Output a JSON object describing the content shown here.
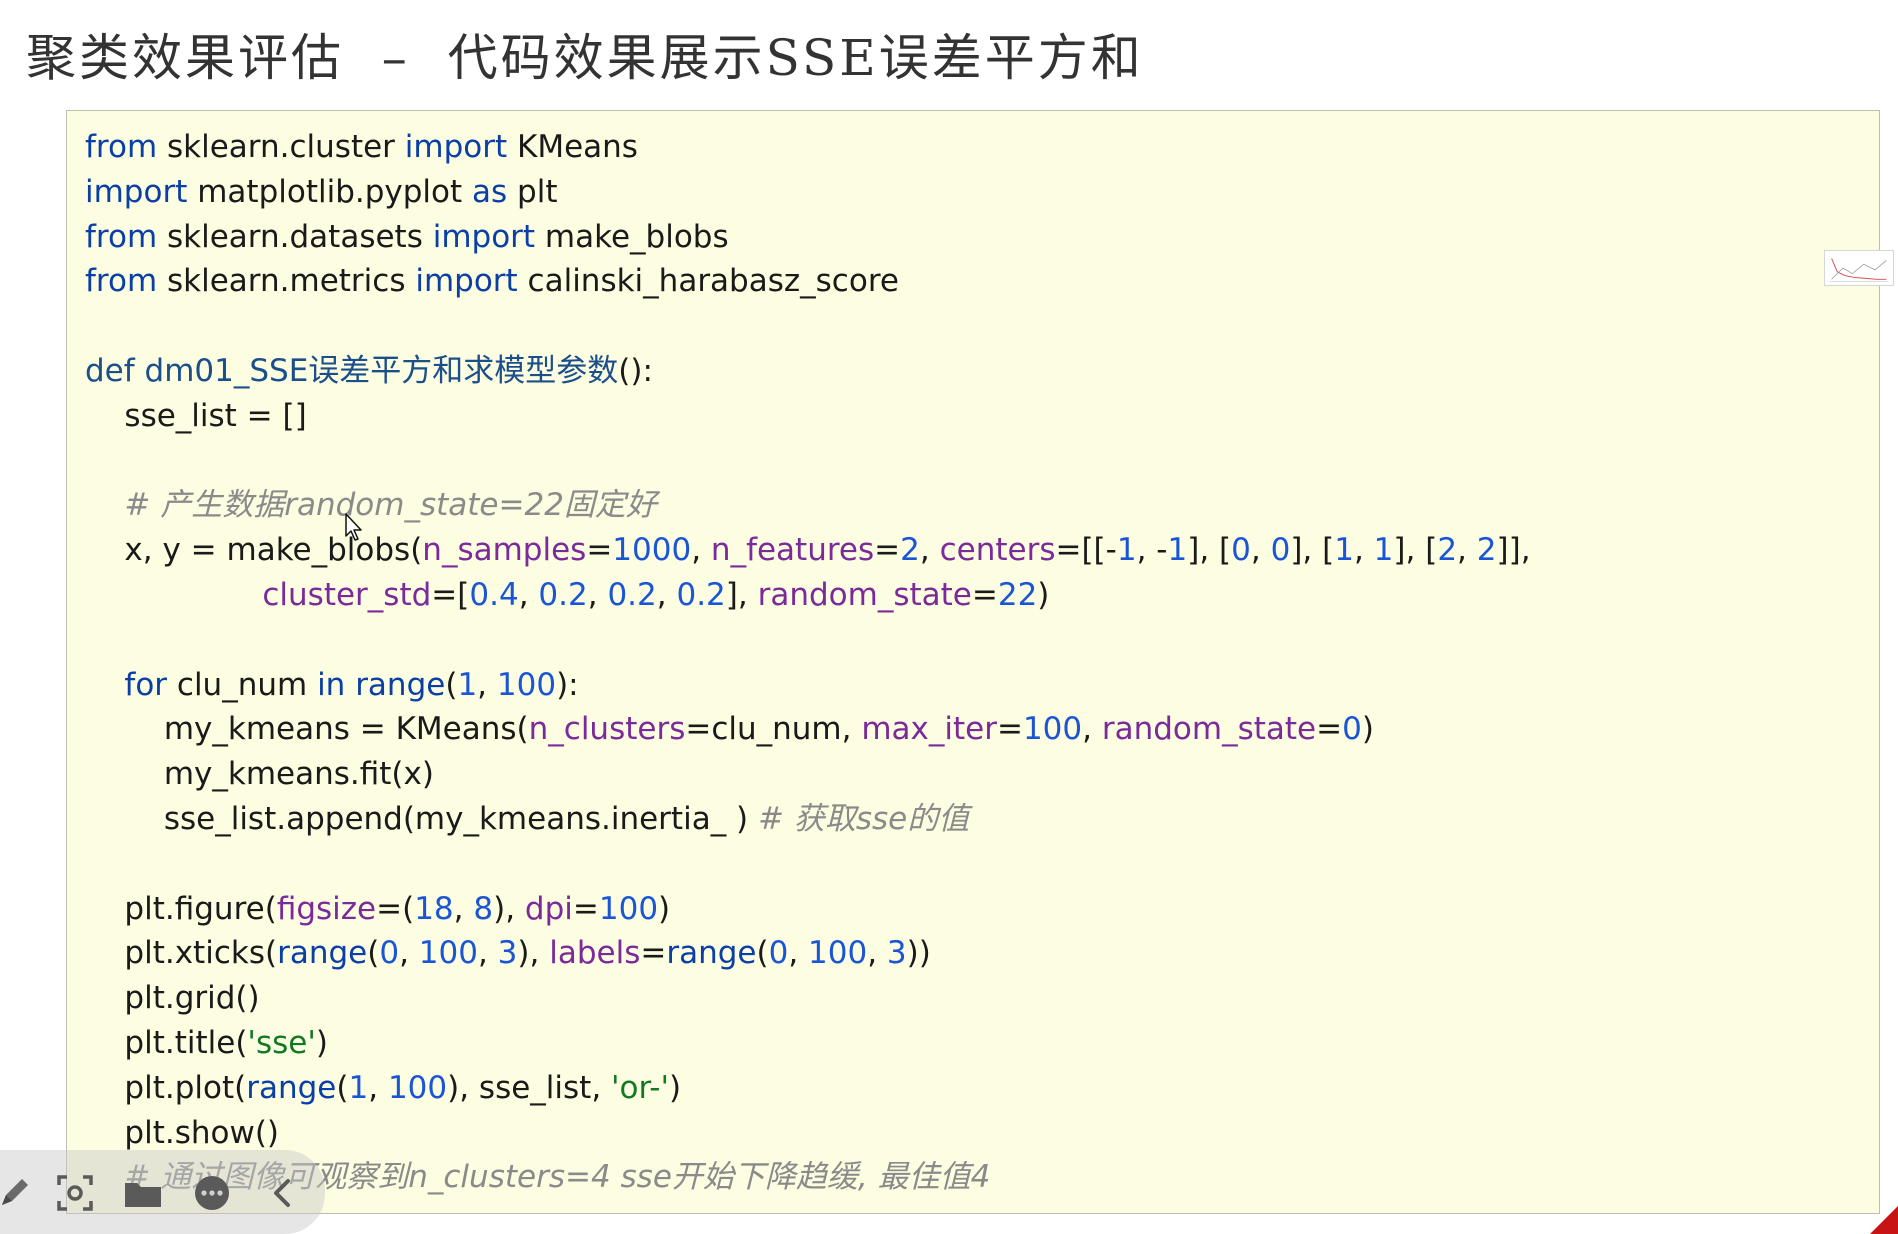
{
  "slide": {
    "title": "聚类效果评估  –  代码效果展示SSE误差平方和"
  },
  "code_lines": [
    [
      {
        "t": "from",
        "c": "kw"
      },
      {
        "t": " sklearn.cluster "
      },
      {
        "t": "import",
        "c": "kw"
      },
      {
        "t": " KMeans"
      }
    ],
    [
      {
        "t": "import",
        "c": "kw"
      },
      {
        "t": " matplotlib.pyplot "
      },
      {
        "t": "as",
        "c": "kw"
      },
      {
        "t": " plt"
      }
    ],
    [
      {
        "t": "from",
        "c": "kw"
      },
      {
        "t": " sklearn.datasets "
      },
      {
        "t": "import",
        "c": "kw"
      },
      {
        "t": " make_blobs"
      }
    ],
    [
      {
        "t": "from",
        "c": "kw"
      },
      {
        "t": " sklearn.metrics "
      },
      {
        "t": "import",
        "c": "kw"
      },
      {
        "t": " calinski_harabasz_score"
      }
    ],
    [],
    [
      {
        "t": "def dm01_SSE误差平方和求模型参数",
        "c": "def"
      },
      {
        "t": "():"
      }
    ],
    [
      {
        "t": "    sse_list = []"
      }
    ],
    [],
    [
      {
        "t": "    # 产生数据random_state=22固定好",
        "c": "cm"
      }
    ],
    [
      {
        "t": "    x, y = make_blobs("
      },
      {
        "t": "n_samples",
        "c": "param"
      },
      {
        "t": "="
      },
      {
        "t": "1000",
        "c": "num"
      },
      {
        "t": ", "
      },
      {
        "t": "n_features",
        "c": "param"
      },
      {
        "t": "="
      },
      {
        "t": "2",
        "c": "num"
      },
      {
        "t": ", "
      },
      {
        "t": "centers",
        "c": "param"
      },
      {
        "t": "=[[-"
      },
      {
        "t": "1",
        "c": "num"
      },
      {
        "t": ", -"
      },
      {
        "t": "1",
        "c": "num"
      },
      {
        "t": "], ["
      },
      {
        "t": "0",
        "c": "num"
      },
      {
        "t": ", "
      },
      {
        "t": "0",
        "c": "num"
      },
      {
        "t": "], ["
      },
      {
        "t": "1",
        "c": "num"
      },
      {
        "t": ", "
      },
      {
        "t": "1",
        "c": "num"
      },
      {
        "t": "], ["
      },
      {
        "t": "2",
        "c": "num"
      },
      {
        "t": ", "
      },
      {
        "t": "2",
        "c": "num"
      },
      {
        "t": "]],"
      }
    ],
    [
      {
        "t": "                  "
      },
      {
        "t": "cluster_std",
        "c": "param"
      },
      {
        "t": "=["
      },
      {
        "t": "0.4",
        "c": "num"
      },
      {
        "t": ", "
      },
      {
        "t": "0.2",
        "c": "num"
      },
      {
        "t": ", "
      },
      {
        "t": "0.2",
        "c": "num"
      },
      {
        "t": ", "
      },
      {
        "t": "0.2",
        "c": "num"
      },
      {
        "t": "], "
      },
      {
        "t": "random_state",
        "c": "param"
      },
      {
        "t": "="
      },
      {
        "t": "22",
        "c": "num"
      },
      {
        "t": ")"
      }
    ],
    [],
    [
      {
        "t": "    "
      },
      {
        "t": "for",
        "c": "kw"
      },
      {
        "t": " clu_num "
      },
      {
        "t": "in",
        "c": "kw"
      },
      {
        "t": " "
      },
      {
        "t": "range",
        "c": "kw"
      },
      {
        "t": "("
      },
      {
        "t": "1",
        "c": "num"
      },
      {
        "t": ", "
      },
      {
        "t": "100",
        "c": "num"
      },
      {
        "t": "):"
      }
    ],
    [
      {
        "t": "        my_kmeans = KMeans("
      },
      {
        "t": "n_clusters",
        "c": "param"
      },
      {
        "t": "=clu_num, "
      },
      {
        "t": "max_iter",
        "c": "param"
      },
      {
        "t": "="
      },
      {
        "t": "100",
        "c": "num"
      },
      {
        "t": ", "
      },
      {
        "t": "random_state",
        "c": "param"
      },
      {
        "t": "="
      },
      {
        "t": "0",
        "c": "num"
      },
      {
        "t": ")"
      }
    ],
    [
      {
        "t": "        my_kmeans.fit(x)"
      }
    ],
    [
      {
        "t": "        sse_list.append(my_kmeans.inertia_ ) "
      },
      {
        "t": "# 获取sse的值",
        "c": "cm"
      }
    ],
    [],
    [
      {
        "t": "    plt.figure("
      },
      {
        "t": "figsize",
        "c": "param"
      },
      {
        "t": "=("
      },
      {
        "t": "18",
        "c": "num"
      },
      {
        "t": ", "
      },
      {
        "t": "8",
        "c": "num"
      },
      {
        "t": "), "
      },
      {
        "t": "dpi",
        "c": "param"
      },
      {
        "t": "="
      },
      {
        "t": "100",
        "c": "num"
      },
      {
        "t": ")"
      }
    ],
    [
      {
        "t": "    plt.xticks("
      },
      {
        "t": "range",
        "c": "kw"
      },
      {
        "t": "("
      },
      {
        "t": "0",
        "c": "num"
      },
      {
        "t": ", "
      },
      {
        "t": "100",
        "c": "num"
      },
      {
        "t": ", "
      },
      {
        "t": "3",
        "c": "num"
      },
      {
        "t": "), "
      },
      {
        "t": "labels",
        "c": "param"
      },
      {
        "t": "="
      },
      {
        "t": "range",
        "c": "kw"
      },
      {
        "t": "("
      },
      {
        "t": "0",
        "c": "num"
      },
      {
        "t": ", "
      },
      {
        "t": "100",
        "c": "num"
      },
      {
        "t": ", "
      },
      {
        "t": "3",
        "c": "num"
      },
      {
        "t": "))"
      }
    ],
    [
      {
        "t": "    plt.grid()"
      }
    ],
    [
      {
        "t": "    plt.title("
      },
      {
        "t": "'sse'",
        "c": "str"
      },
      {
        "t": ")"
      }
    ],
    [
      {
        "t": "    plt.plot("
      },
      {
        "t": "range",
        "c": "kw"
      },
      {
        "t": "("
      },
      {
        "t": "1",
        "c": "num"
      },
      {
        "t": ", "
      },
      {
        "t": "100",
        "c": "num"
      },
      {
        "t": "), sse_list, "
      },
      {
        "t": "'or-'",
        "c": "str"
      },
      {
        "t": ")"
      }
    ],
    [
      {
        "t": "    plt.show()"
      }
    ],
    [
      {
        "t": "    # 通过图像可观察到n_clusters=4 sse开始下降趋缓, 最佳值4",
        "c": "cm"
      }
    ]
  ],
  "colors": {
    "code_background": "#fdfde2",
    "keyword": "#0b3fa8",
    "number": "#1a55d6",
    "param": "#7a2a9a",
    "string": "#0f7a22",
    "comment": "#8a8a8a",
    "corner_marker": "#c81414"
  },
  "toolbar": {
    "tools": [
      {
        "name": "pen-icon"
      },
      {
        "name": "screenshot-icon"
      },
      {
        "name": "folder-icon"
      },
      {
        "name": "more-icon"
      },
      {
        "name": "collapse-icon"
      }
    ]
  }
}
